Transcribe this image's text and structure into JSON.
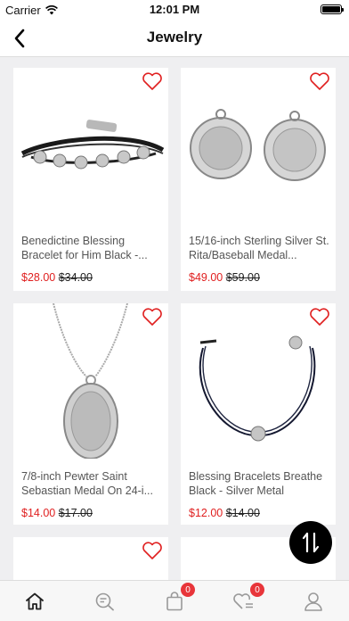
{
  "status": {
    "carrier": "Carrier",
    "time": "12:01 PM"
  },
  "nav": {
    "title": "Jewelry"
  },
  "products": [
    {
      "name": "Benedictine Blessing Bracelet for Him Black -...",
      "price": "$28.00",
      "old_price": "$34.00"
    },
    {
      "name": "15/16-inch Sterling Silver St. Rita/Baseball Medal...",
      "price": "$49.00",
      "old_price": "$59.00"
    },
    {
      "name": "7/8-inch Pewter Saint Sebastian Medal On 24-i...",
      "price": "$14.00",
      "old_price": "$17.00"
    },
    {
      "name": "Blessing Bracelets Breathe Black - Silver Metal",
      "price": "$12.00",
      "old_price": "$14.00"
    }
  ],
  "tabs": {
    "cart_count": "0",
    "wishlist_count": "0"
  },
  "colors": {
    "accent": "#e02020",
    "badge": "#e8353a"
  }
}
